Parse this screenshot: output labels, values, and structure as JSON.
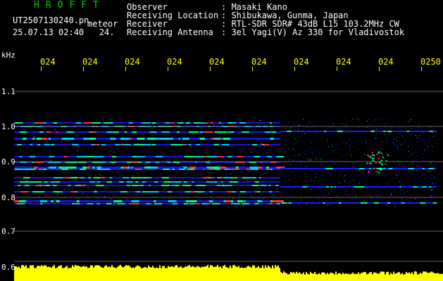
{
  "header": {
    "app_title": "HROFFT",
    "file_name": "UT2507130240.pn",
    "mode_label": "meteor",
    "date_time": "25.07.13 02:40   24."
  },
  "station_info": [
    {
      "label": "Observer",
      "value": ": Masaki Kano"
    },
    {
      "label": "Receiving Location",
      "value": ": Shibukawa, Gunma, Japan"
    },
    {
      "label": "Receiver",
      "value": ": RTL-SDR SDR# 43dB L15 103.2MHz CW"
    },
    {
      "label": "Receiving Antenna",
      "value": ": 3el Yagi(V) Az 330 for Vladivostok"
    }
  ],
  "axis": {
    "unit": "kHz",
    "freq_ticks": [
      "1.1",
      "1.0",
      "0.9",
      "0.8",
      "0.7",
      "0.6"
    ],
    "time_labels": [
      "024",
      "024",
      "024",
      "024",
      "024",
      "024",
      "024",
      "024",
      "024",
      "0250"
    ]
  },
  "colors": {
    "title": "#00d000",
    "time_labels": "#ffff00",
    "background": "#000000",
    "signal_low": "#1a1aff",
    "signal_mid": "#00ff80",
    "signal_high": "#ff3030",
    "level_bar": "#ffff00"
  }
}
